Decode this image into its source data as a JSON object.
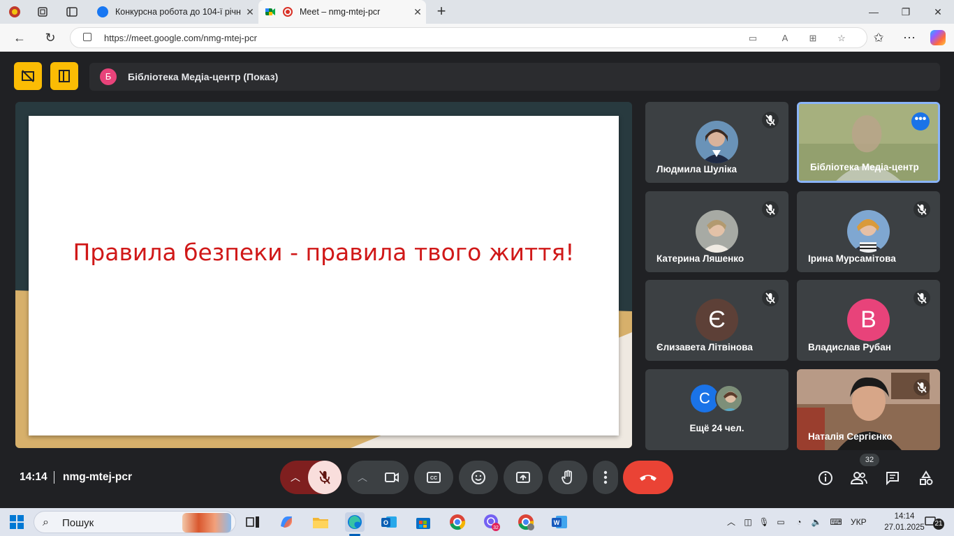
{
  "browser": {
    "tabs": [
      {
        "title": "Конкурсна робота до 104-ї річн",
        "favicon": "facebook-icon",
        "active": false
      },
      {
        "title": "Meet – nmg-mtej-pcr",
        "favicon": "google-meet-icon",
        "active": true
      }
    ],
    "url": "https://meet.google.com/nmg-mtej-pcr"
  },
  "meet": {
    "presenter_initial": "Б",
    "presenter_label": "Бібліотека Медіа-центр (Показ)",
    "slide_title": "Правила безпеки - правила твого життя!",
    "participants": [
      {
        "name": "Людмила Шуліка",
        "type": "photo",
        "muted": true
      },
      {
        "name": "Бібліотека Медіа-центр",
        "type": "camera",
        "muted": false,
        "speaking": true
      },
      {
        "name": "Катерина Ляшенко",
        "type": "photo",
        "muted": true
      },
      {
        "name": "Ірина Мурсамітова",
        "type": "photo",
        "muted": true
      },
      {
        "name": "Єлизавета Літвінова",
        "type": "letter",
        "letter": "Є",
        "color": "#5d4037",
        "muted": true
      },
      {
        "name": "Владислав Рубан",
        "type": "letter",
        "letter": "В",
        "color": "#e8437a",
        "muted": true
      },
      {
        "name": "Наталія Сергієнко",
        "type": "camera",
        "muted": true
      }
    ],
    "others": {
      "letter": "С",
      "label": "Ещё 24 чел."
    },
    "time": "14:14",
    "meeting_code": "nmg-mtej-pcr",
    "participant_count": "32",
    "colors": {
      "accent": "#fbbc04",
      "hangup": "#ea4335",
      "mic_off_bg": "#f9dedc",
      "speaking_border": "#8ab4f8"
    }
  },
  "taskbar": {
    "search_label": "Пошук",
    "viber_badge": "32",
    "language": "УКР",
    "time": "14:14",
    "date": "27.01.2025",
    "notification_count": "21"
  }
}
